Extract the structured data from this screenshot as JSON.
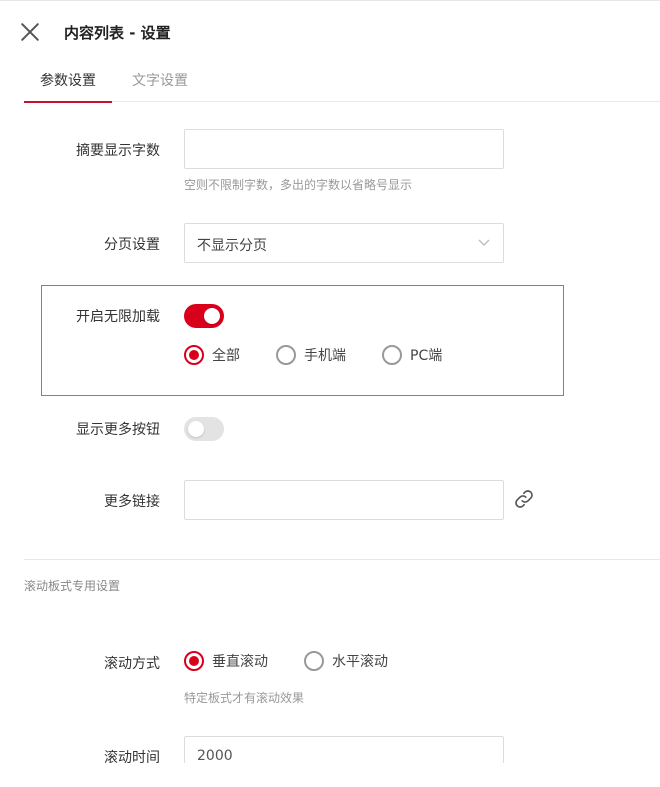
{
  "header": {
    "title": "内容列表 - 设置"
  },
  "tabs": [
    {
      "label": "参数设置"
    },
    {
      "label": "文字设置"
    }
  ],
  "summary": {
    "label": "摘要显示字数",
    "value": "",
    "placeholder": "",
    "hint": "空则不限制字数，多出的字数以省略号显示"
  },
  "pagination": {
    "label": "分页设置",
    "selected": "不显示分页"
  },
  "infinite_load": {
    "label": "开启无限加载",
    "enabled": true,
    "options": [
      {
        "label": "全部",
        "checked": true
      },
      {
        "label": "手机端",
        "checked": false
      },
      {
        "label": "PC端",
        "checked": false
      }
    ]
  },
  "show_more": {
    "label": "显示更多按钮",
    "enabled": false
  },
  "more_link": {
    "label": "更多链接",
    "value": "",
    "icon": "link-icon"
  },
  "scroll_section": {
    "title": "滚动板式专用设置",
    "mode_label": "滚动方式",
    "mode_options": [
      {
        "label": "垂直滚动",
        "checked": true
      },
      {
        "label": "水平滚动",
        "checked": false
      }
    ],
    "mode_hint": "特定板式才有滚动效果",
    "time_label": "滚动时间",
    "time_value": "2000"
  },
  "colors": {
    "accent": "#d9001b",
    "highlight_border": "#e05a5a"
  }
}
